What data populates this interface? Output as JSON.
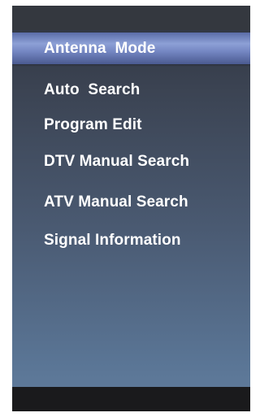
{
  "menu": {
    "selected": {
      "label": "Antenna  Mode"
    },
    "items": [
      {
        "label": "Auto  Search"
      },
      {
        "label": "Program Edit"
      },
      {
        "label": "DTV Manual Search"
      },
      {
        "label": "ATV Manual Search"
      },
      {
        "label": "Signal Information"
      }
    ]
  },
  "colors": {
    "selection_highlight": "#8da0d6",
    "background_top": "#3b4352",
    "background_bottom": "#5d7898",
    "bottom_bar": "#1a1a1c",
    "text": "#ffffff"
  }
}
